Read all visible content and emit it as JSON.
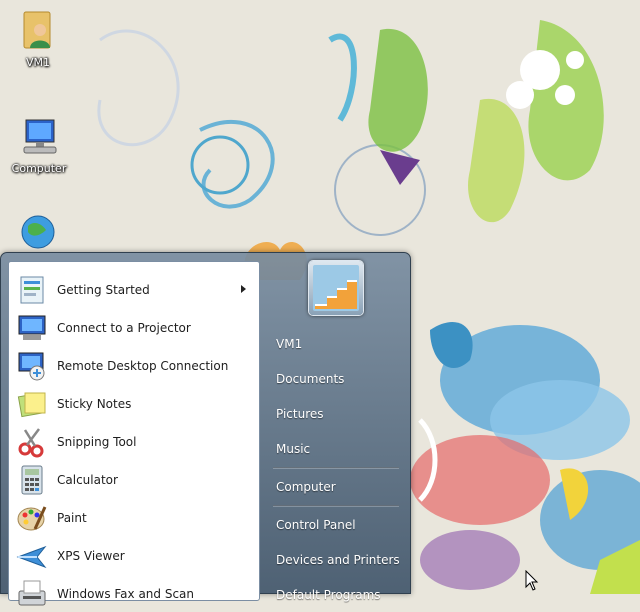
{
  "desktop": {
    "icons": [
      {
        "label": "VM1"
      },
      {
        "label": "Computer"
      }
    ]
  },
  "start_menu": {
    "programs": [
      {
        "label": "Getting Started",
        "has_submenu": true
      },
      {
        "label": "Connect to a Projector"
      },
      {
        "label": "Remote Desktop Connection"
      },
      {
        "label": "Sticky Notes"
      },
      {
        "label": "Snipping Tool"
      },
      {
        "label": "Calculator"
      },
      {
        "label": "Paint"
      },
      {
        "label": "XPS Viewer"
      },
      {
        "label": "Windows Fax and Scan"
      }
    ],
    "places": [
      {
        "label": "VM1"
      },
      {
        "label": "Documents"
      },
      {
        "label": "Pictures"
      },
      {
        "label": "Music"
      },
      {
        "label": "Computer"
      },
      {
        "label": "Control Panel"
      },
      {
        "label": "Devices and Printers"
      },
      {
        "label": "Default Programs"
      }
    ]
  }
}
